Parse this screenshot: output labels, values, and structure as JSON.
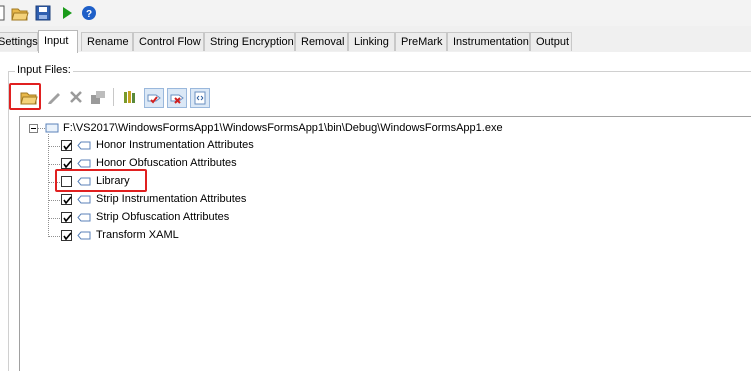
{
  "tabs": [
    "Settings",
    "Input",
    "Rename",
    "Control Flow",
    "String Encryption",
    "Removal",
    "Linking",
    "PreMark",
    "Instrumentation",
    "Output"
  ],
  "active_tab": "Input",
  "group_title": "Input Files:",
  "tree": {
    "root": "F:\\VS2017\\WindowsFormsApp1\\WindowsFormsApp1\\bin\\Debug\\WindowsFormsApp1.exe",
    "items": [
      {
        "label": "Honor Instrumentation Attributes",
        "checked": true
      },
      {
        "label": "Honor Obfuscation Attributes",
        "checked": true
      },
      {
        "label": "Library",
        "checked": false
      },
      {
        "label": "Strip Instrumentation Attributes",
        "checked": true
      },
      {
        "label": "Strip Obfuscation Attributes",
        "checked": true
      },
      {
        "label": "Transform XAML",
        "checked": true
      }
    ]
  },
  "colors": {
    "highlight": "#e02020",
    "play": "#1a9a1a",
    "help": "#1e5fc8"
  },
  "icons": [
    "new-icon",
    "open-folder-icon",
    "save-icon",
    "play-icon",
    "help-icon",
    "add-file-icon",
    "edit-icon",
    "remove-icon",
    "settings-icon",
    "library-icon",
    "tag-add-icon",
    "tag-remove-icon",
    "xaml-icon"
  ]
}
